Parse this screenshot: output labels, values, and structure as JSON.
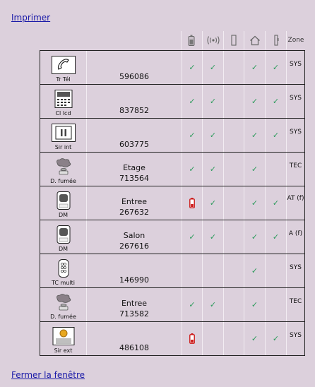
{
  "links": {
    "print": "Imprimer",
    "close": "Fermer la fenêtre"
  },
  "header": {
    "zone_label": "Zone",
    "icons": [
      "battery-icon",
      "radio-signal-icon",
      "door-contact-icon",
      "house-icon",
      "post-icon"
    ]
  },
  "colors": {
    "background": "#dcd0dc",
    "check": "#2a9a5a",
    "battery_alert": "#cc1a1a",
    "link": "#1a1aa8"
  },
  "rows": [
    {
      "icon": "phone-transmitter-icon",
      "type": "Tr Tél",
      "name": "",
      "code": "596086",
      "battery_low": false,
      "radio": true,
      "door": false,
      "house": true,
      "post": true,
      "zone": "SYS",
      "batt_ok": true
    },
    {
      "icon": "keypad-display-icon",
      "type": "Cl lcd",
      "name": "",
      "code": "837852",
      "battery_low": false,
      "radio": true,
      "door": false,
      "house": true,
      "post": true,
      "zone": "SYS",
      "batt_ok": true
    },
    {
      "icon": "indoor-siren-icon",
      "type": "Sir int",
      "name": "",
      "code": "603775",
      "battery_low": false,
      "radio": true,
      "door": false,
      "house": true,
      "post": true,
      "zone": "SYS",
      "batt_ok": true
    },
    {
      "icon": "smoke-detector-icon",
      "type": "D. fumée",
      "name": "Etage",
      "code": "713564",
      "battery_low": false,
      "radio": true,
      "door": false,
      "house": true,
      "post": false,
      "zone": "TEC",
      "batt_ok": true
    },
    {
      "icon": "motion-detector-icon",
      "type": "DM",
      "name": "Entree",
      "code": "267632",
      "battery_low": true,
      "radio": true,
      "door": false,
      "house": true,
      "post": true,
      "zone": "AT (f)",
      "batt_ok": false
    },
    {
      "icon": "motion-detector-icon",
      "type": "DM",
      "name": "Salon",
      "code": "267616",
      "battery_low": false,
      "radio": true,
      "door": false,
      "house": true,
      "post": true,
      "zone": "A (f)",
      "batt_ok": true
    },
    {
      "icon": "remote-control-icon",
      "type": "TC multi",
      "name": "",
      "code": "146990",
      "battery_low": false,
      "radio": false,
      "door": false,
      "house": true,
      "post": false,
      "zone": "SYS",
      "batt_ok": false
    },
    {
      "icon": "smoke-detector-icon",
      "type": "D. fumée",
      "name": "Entree",
      "code": "713582",
      "battery_low": false,
      "radio": true,
      "door": false,
      "house": true,
      "post": false,
      "zone": "TEC",
      "batt_ok": true
    },
    {
      "icon": "outdoor-siren-icon",
      "type": "Sir ext",
      "name": "",
      "code": "486108",
      "battery_low": true,
      "radio": false,
      "door": false,
      "house": true,
      "post": true,
      "zone": "SYS",
      "batt_ok": false
    }
  ]
}
